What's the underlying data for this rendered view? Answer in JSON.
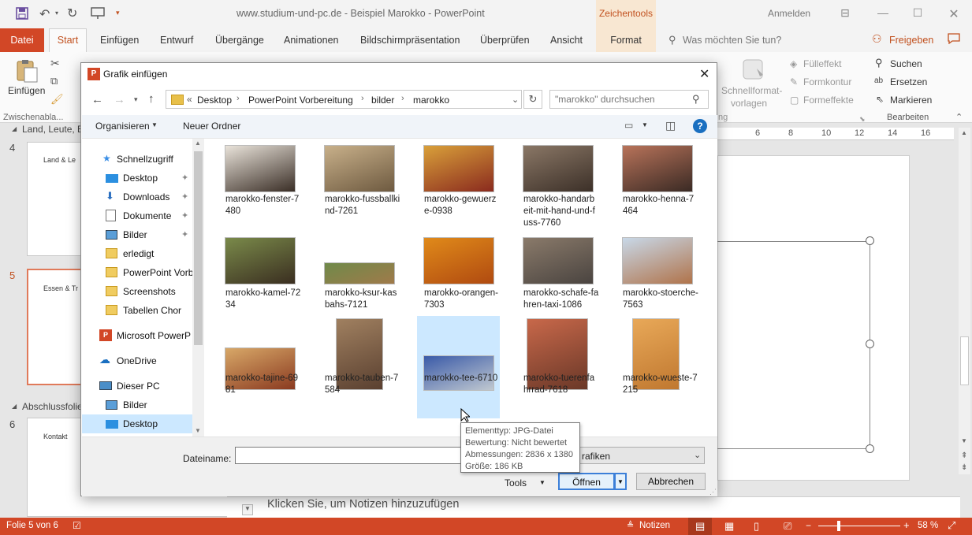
{
  "window": {
    "title": "www.studium-und-pc.de - Beispiel Marokko  -  PowerPoint",
    "context_tab": "Zeichentools",
    "signin": "Anmelden"
  },
  "ribbon": {
    "tabs": [
      "Datei",
      "Start",
      "Einfügen",
      "Entwurf",
      "Übergänge",
      "Animationen",
      "Bildschirmpräsentation",
      "Überprüfen",
      "Ansicht",
      "Format"
    ],
    "tell_me": "Was möchten Sie tun?",
    "share": "Freigeben",
    "paste_label": "Einfügen",
    "clipboard_group": "Zwischenabla...",
    "fuelleffekt": "Fülleffekt",
    "formkontur": "Formkontur",
    "formeffekte": "Formeffekte",
    "schnellformat_1": "Schnellformat-",
    "schnellformat_2": "vorlagen",
    "zeichnen_group_tail": "ng",
    "suchen": "Suchen",
    "ersetzen": "Ersetzen",
    "markieren": "Markieren",
    "bearbeiten_group": "Bearbeiten"
  },
  "slides": {
    "section1": "Land, Leute, E",
    "section3": "Abschlussfolie",
    "items": [
      {
        "number": "4",
        "text": "Land & Le"
      },
      {
        "number": "5",
        "text": "Essen & Tr"
      },
      {
        "number": "6",
        "text": "Kontakt"
      }
    ]
  },
  "ruler_ticks": [
    "6",
    "8",
    "10",
    "12",
    "14",
    "16"
  ],
  "notes_placeholder": "Klicken Sie, um Notizen hinzuzufügen",
  "dialog": {
    "title": "Grafik einfügen",
    "breadcrumb": [
      "Desktop",
      "PowerPoint Vorbereitung",
      "bilder",
      "marokko"
    ],
    "breadcrumb_prefix": "«",
    "search_placeholder": "\"marokko\" durchsuchen",
    "organize": "Organisieren",
    "new_folder": "Neuer Ordner",
    "nav": [
      {
        "label": "Schnellzugriff",
        "icon": "star-icon",
        "pinned": false
      },
      {
        "label": "Desktop",
        "icon": "desktop-icon",
        "pinned": true
      },
      {
        "label": "Downloads",
        "icon": "download-icon",
        "pinned": true
      },
      {
        "label": "Dokumente",
        "icon": "documents-icon",
        "pinned": true
      },
      {
        "label": "Bilder",
        "icon": "pictures-icon",
        "pinned": true
      },
      {
        "label": "erledigt",
        "icon": "folder-icon",
        "pinned": false
      },
      {
        "label": "PowerPoint Vorb",
        "icon": "folder-icon",
        "pinned": false
      },
      {
        "label": "Screenshots",
        "icon": "folder-icon",
        "pinned": false
      },
      {
        "label": "Tabellen Chor",
        "icon": "folder-icon",
        "pinned": false
      },
      {
        "label": "Microsoft PowerP",
        "icon": "powerpoint-icon",
        "pinned": false
      },
      {
        "label": "OneDrive",
        "icon": "onedrive-icon",
        "pinned": false
      },
      {
        "label": "Dieser PC",
        "icon": "computer-icon",
        "pinned": false
      },
      {
        "label": "Bilder",
        "icon": "pictures-icon",
        "pinned": false
      },
      {
        "label": "Desktop",
        "icon": "desktop-icon",
        "pinned": false
      }
    ],
    "files": [
      {
        "name": "marokko-fenster-7480",
        "colors": [
          "#e9e3da",
          "#3a2e26"
        ]
      },
      {
        "name": "marokko-fussballkind-7261",
        "colors": [
          "#c8b08a",
          "#6e5a40"
        ]
      },
      {
        "name": "marokko-gewuerze-0938",
        "colors": [
          "#d9a03a",
          "#8a2a1e"
        ]
      },
      {
        "name": "marokko-handarbeit-mit-hand-und-fuss-7760",
        "colors": [
          "#8a7766",
          "#3c3028"
        ]
      },
      {
        "name": "marokko-henna-7464",
        "colors": [
          "#b8735a",
          "#3a2a24"
        ]
      },
      {
        "name": "marokko-kamel-7234",
        "colors": [
          "#7a8a4a",
          "#3a2e20"
        ]
      },
      {
        "name": "marokko-ksur-kasbahs-7121",
        "colors": [
          "#6f8a4a",
          "#a07a4a"
        ]
      },
      {
        "name": "marokko-orangen-7303",
        "colors": [
          "#e08a1a",
          "#b04a10"
        ]
      },
      {
        "name": "marokko-schafe-fahren-taxi-1086",
        "colors": [
          "#8a7a6a",
          "#4a4440"
        ]
      },
      {
        "name": "marokko-stoerche-7563",
        "colors": [
          "#c8d8e8",
          "#b0734a"
        ]
      },
      {
        "name": "marokko-tajine-6981",
        "colors": [
          "#d8a868",
          "#8a3a20"
        ]
      },
      {
        "name": "marokko-tauben-7584",
        "colors": [
          "#a08060",
          "#5a4030"
        ]
      },
      {
        "name": "marokko-tee-6710",
        "colors": [
          "#3a5aa8",
          "#c0c8d0"
        ]
      },
      {
        "name": "marokko-tuerenfahrrad-7618",
        "colors": [
          "#c8684a",
          "#6a3828"
        ]
      },
      {
        "name": "marokko-wueste-7215",
        "colors": [
          "#e8a858",
          "#c07830"
        ]
      }
    ],
    "filename_label": "Dateiname:",
    "filename_value": "",
    "filetype_value": "rafiken",
    "tools": "Tools",
    "open": "Öffnen",
    "cancel": "Abbrechen",
    "tooltip": {
      "line1": "Elementtyp: JPG-Datei",
      "line2": "Bewertung: Nicht bewertet",
      "line3": "Abmessungen: 2836 x 1380",
      "line4": "Größe: 186 KB"
    }
  },
  "status": {
    "slide": "Folie 5 von 6",
    "notes": "Notizen",
    "zoom": "58 %"
  },
  "colors": {
    "accent": "#d24726",
    "selection": "#cce8ff"
  }
}
